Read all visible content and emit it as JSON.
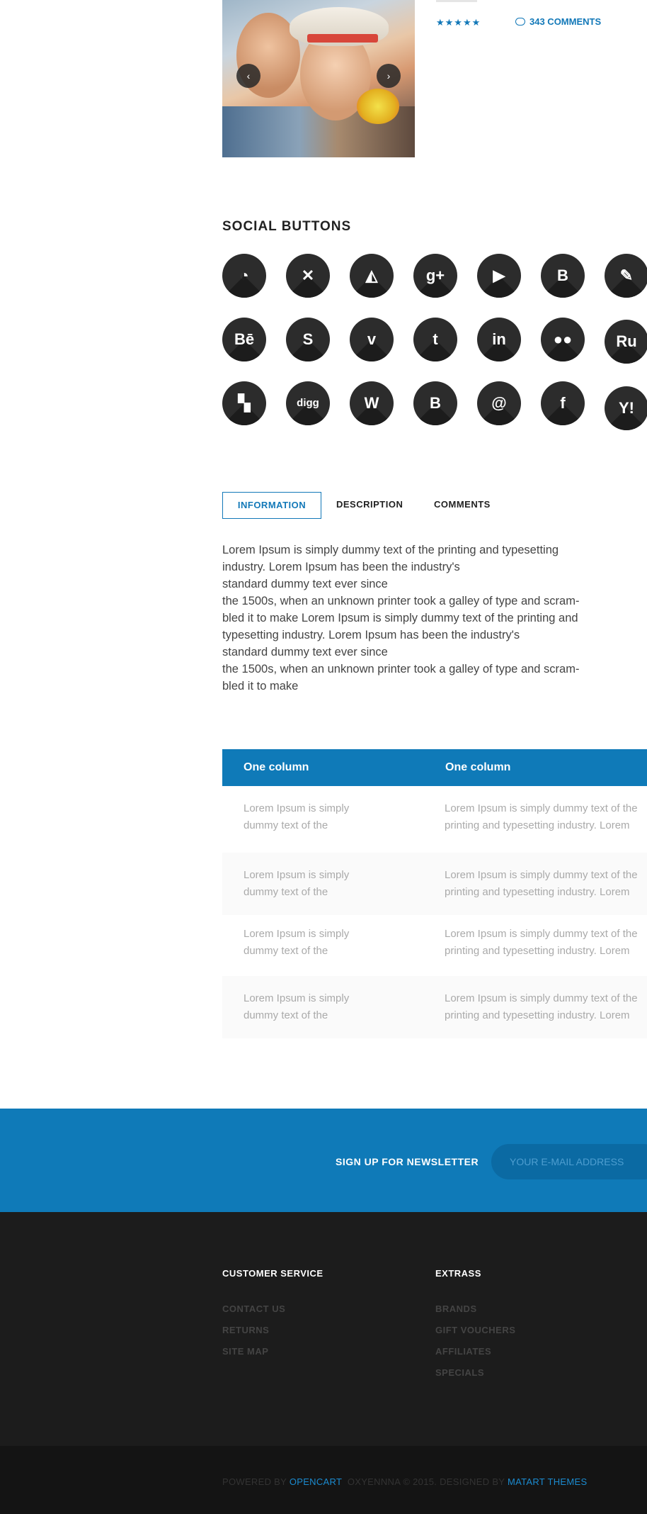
{
  "product": {
    "prev_icon": "‹",
    "next_icon": "›",
    "stars": "★★★★★",
    "rating": 5,
    "comments_label": "343 COMMENTS"
  },
  "social": {
    "title": "SOCIAL BUTTONS",
    "icons": [
      "rss-icon",
      "xing-icon",
      "deviantart-icon",
      "google-plus-icon",
      "youtube-icon",
      "blogger-icon",
      "evernote-icon",
      "behance-icon",
      "skype-icon",
      "vimeo-icon",
      "tumblr-icon",
      "linkedin-icon",
      "myspace-icon",
      "livejournal-icon",
      "delicious-icon",
      "digg-icon",
      "wordpress-icon",
      "bebo-icon",
      "mail-icon",
      "facebook-icon",
      "yahoo-icon"
    ],
    "glyphs": {
      "rss": "◔",
      "xing": "✕",
      "deviantart": "◭",
      "gplus": "g+",
      "youtube": "▶",
      "blogger": "B",
      "evernote": "✎",
      "behance": "Bē",
      "skype": "S",
      "vimeo": "v",
      "tumblr": "t",
      "linkedin": "in",
      "myspace": "●●",
      "livejournal": "Ru",
      "delicious": "▚",
      "digg": "digg",
      "wordpress": "W",
      "bebo": "B",
      "mail": "@",
      "facebook": "f",
      "yahoo": "Y!"
    }
  },
  "tabs": {
    "information": "INFORMATION",
    "description": "DESCRIPTION",
    "comments": "COMMENTS"
  },
  "info_text": "Lorem Ipsum is simply dummy text of the printing and typesetting\nindustry. Lorem Ipsum has been the industry's\nstandard dummy text ever since\nthe 1500s, when an unknown printer took a galley of type and scram-\nbled it to make Lorem Ipsum is simply dummy text of the printing and\ntypesetting industry. Lorem Ipsum has been the industry's\nstandard dummy text ever since\nthe 1500s, when an unknown printer took a galley of type and scram-\nbled it to make",
  "table": {
    "headers": [
      "One column",
      "One column"
    ],
    "rows": [
      {
        "c1": "Lorem Ipsum is simply dummy text of the",
        "c2a": "Lorem Ipsum is simply dummy text of the",
        "c2b": "printing and typesetting industry. Lorem"
      },
      {
        "c1": "Lorem Ipsum is simply dummy text of the",
        "c2a": "Lorem Ipsum is simply dummy text of the",
        "c2b": "printing and typesetting industry. Lorem"
      },
      {
        "c1": "Lorem Ipsum is simply dummy text of the",
        "c2a": "Lorem Ipsum is simply dummy text of the",
        "c2b": "printing and typesetting industry. Lorem"
      },
      {
        "c1": "Lorem Ipsum is simply dummy text of the",
        "c2a": "Lorem Ipsum is simply dummy text of the",
        "c2b": "printing and typesetting industry. Lorem"
      }
    ]
  },
  "newsletter": {
    "label": "SIGN UP FOR NEWSLETTER",
    "placeholder": "YOUR E-MAIL ADDRESS"
  },
  "footer": {
    "customer_service": {
      "title": "CUSTOMER SERVICE",
      "links": [
        "CONTACT US",
        "RETURNS",
        "SITE MAP"
      ]
    },
    "extras": {
      "title": "EXTRASS",
      "links": [
        "BRANDS",
        "GIFT VOUCHERS",
        "AFFILIATES",
        "SPECIALS"
      ]
    },
    "copyright": {
      "powered": "POWERED BY",
      "opencart": "OPENCART",
      "middle": "OXYENNNA © 2015. DESIGNED BY",
      "designer": "MATART THEMES"
    }
  },
  "colors": {
    "accent": "#0f7ab8",
    "dark": "#1c1c1c",
    "icon_bg": "#2c2c2c"
  }
}
